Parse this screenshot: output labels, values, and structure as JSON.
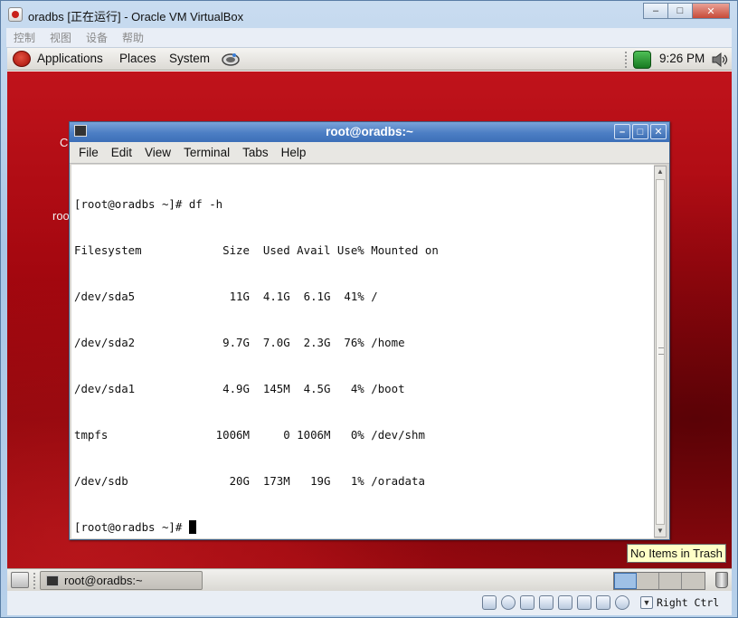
{
  "host_window": {
    "title": "oradbs [正在运行] - Oracle VM VirtualBox",
    "menu": [
      "控制",
      "视图",
      "设备",
      "帮助"
    ],
    "controls": {
      "minimize": "–",
      "maximize": "□",
      "close": "✕"
    }
  },
  "top_panel": {
    "applications": "Applications",
    "places": "Places",
    "system": "System",
    "clock": "9:26 PM"
  },
  "desktop": {
    "fragments": [
      "C",
      "roo"
    ]
  },
  "terminal": {
    "title": "root@oradbs:~",
    "menu": [
      "File",
      "Edit",
      "View",
      "Terminal",
      "Tabs",
      "Help"
    ],
    "lines": [
      "[root@oradbs ~]# df -h",
      "Filesystem            Size  Used Avail Use% Mounted on",
      "/dev/sda5              11G  4.1G  6.1G  41% /",
      "/dev/sda2             9.7G  7.0G  2.3G  76% /home",
      "/dev/sda1             4.9G  145M  4.5G   4% /boot",
      "tmpfs                1006M     0 1006M   0% /dev/shm",
      "/dev/sdb               20G  173M   19G   1% /oradata"
    ],
    "prompt": "[root@oradbs ~]# ",
    "controls": {
      "minimize": "–",
      "maximize": "□",
      "close": "✕"
    }
  },
  "tooltip": {
    "text": "No Items in Trash"
  },
  "bottom_panel": {
    "task_label": "root@oradbs:~",
    "workspace_count": 4,
    "active_workspace": 1
  },
  "status_bar": {
    "host_key": "Right Ctrl"
  }
}
